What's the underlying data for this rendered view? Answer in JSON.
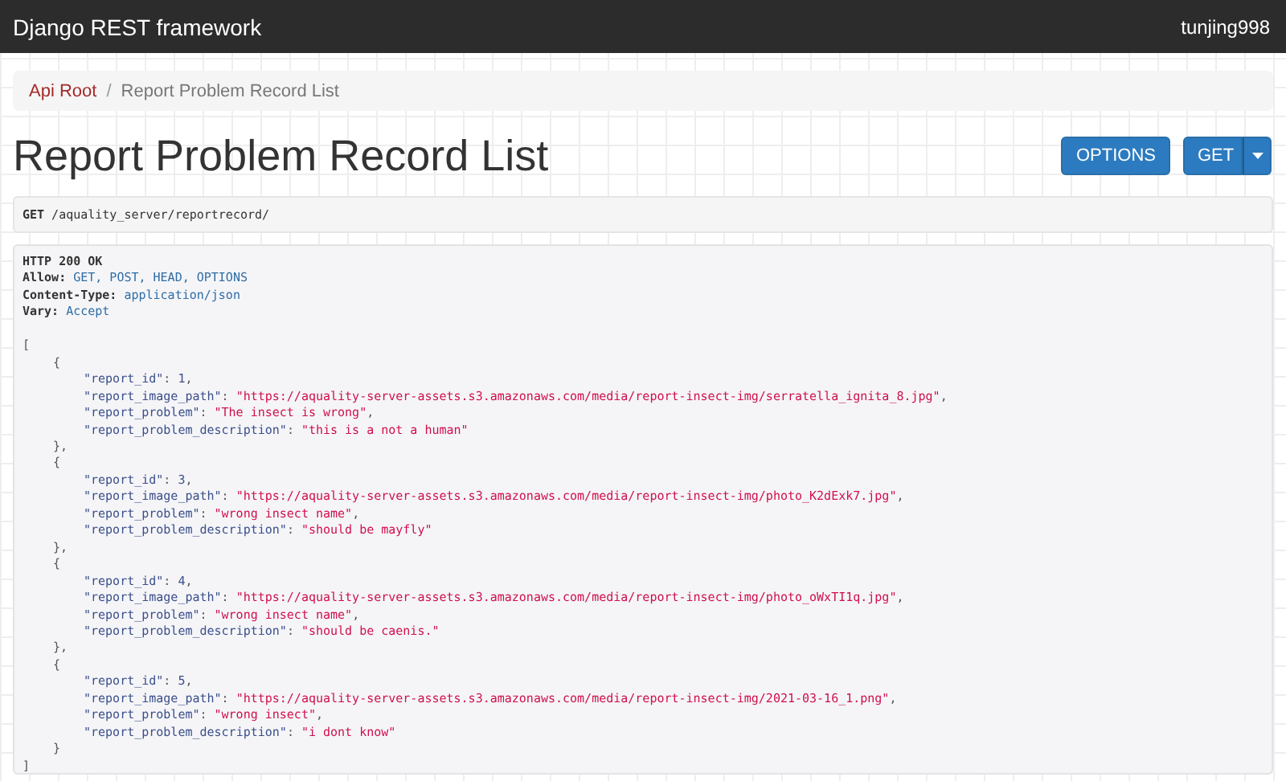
{
  "navbar": {
    "brand": "Django REST framework",
    "user": "tunjing998"
  },
  "breadcrumb": [
    {
      "label": "Api Root",
      "selected": false
    },
    {
      "sep": "/",
      "label": "Report Problem Record List",
      "selected": true
    }
  ],
  "title": "Report Problem Record List",
  "buttons": [
    {
      "label": "OPTIONS",
      "kind": "plain"
    },
    {
      "label": "GET",
      "kind": "split"
    }
  ],
  "request": {
    "method": "GET",
    "path": "/aquality_server/reportrecord/"
  },
  "response": {
    "status": "HTTP 200 OK",
    "headers": [
      {
        "name": "Allow:",
        "value": "GET, POST, HEAD, OPTIONS"
      },
      {
        "name": "Content-Type:",
        "value": "application/json"
      },
      {
        "name": "Vary:",
        "value": "Accept"
      }
    ],
    "open": "[",
    "close": "]",
    "items": [
      {
        "open": "{",
        "close": "},",
        "fields": [
          {
            "key": "\"report_id\"",
            "sep": ":",
            "value": "1",
            "kind": "number",
            "end": ","
          },
          {
            "key": "\"report_image_path\"",
            "sep": ":",
            "value": "\"https://aquality-server-assets.s3.amazonaws.com/media/report-insect-img/serratella_ignita_8.jpg\"",
            "kind": "string",
            "end": ","
          },
          {
            "key": "\"report_problem\"",
            "sep": ":",
            "value": "\"The insect is wrong\"",
            "kind": "string",
            "end": ","
          },
          {
            "key": "\"report_problem_description\"",
            "sep": ":",
            "value": "\"this is a not a human\"",
            "kind": "string"
          }
        ]
      },
      {
        "open": "{",
        "close": "},",
        "fields": [
          {
            "key": "\"report_id\"",
            "sep": ":",
            "value": "3",
            "kind": "number",
            "end": ","
          },
          {
            "key": "\"report_image_path\"",
            "sep": ":",
            "value": "\"https://aquality-server-assets.s3.amazonaws.com/media/report-insect-img/photo_K2dExk7.jpg\"",
            "kind": "string",
            "end": ","
          },
          {
            "key": "\"report_problem\"",
            "sep": ":",
            "value": "\"wrong insect name\"",
            "kind": "string",
            "end": ","
          },
          {
            "key": "\"report_problem_description\"",
            "sep": ":",
            "value": "\"should be mayfly\"",
            "kind": "string"
          }
        ]
      },
      {
        "open": "{",
        "close": "},",
        "fields": [
          {
            "key": "\"report_id\"",
            "sep": ":",
            "value": "4",
            "kind": "number",
            "end": ","
          },
          {
            "key": "\"report_image_path\"",
            "sep": ":",
            "value": "\"https://aquality-server-assets.s3.amazonaws.com/media/report-insect-img/photo_oWxTI1q.jpg\"",
            "kind": "string",
            "end": ","
          },
          {
            "key": "\"report_problem\"",
            "sep": ":",
            "value": "\"wrong insect name\"",
            "kind": "string",
            "end": ","
          },
          {
            "key": "\"report_problem_description\"",
            "sep": ":",
            "value": "\"should be caenis.\"",
            "kind": "string"
          }
        ]
      },
      {
        "open": "{",
        "close": "}",
        "fields": [
          {
            "key": "\"report_id\"",
            "sep": ":",
            "value": "5",
            "kind": "number",
            "end": ","
          },
          {
            "key": "\"report_image_path\"",
            "sep": ":",
            "value": "\"https://aquality-server-assets.s3.amazonaws.com/media/report-insect-img/2021-03-16_1.png\"",
            "kind": "string",
            "end": ","
          },
          {
            "key": "\"report_problem\"",
            "sep": ":",
            "value": "\"wrong insect\"",
            "kind": "string",
            "end": ","
          },
          {
            "key": "\"report_problem_description\"",
            "sep": ":",
            "value": "\"i dont know\"",
            "kind": "string"
          }
        ]
      }
    ]
  }
}
